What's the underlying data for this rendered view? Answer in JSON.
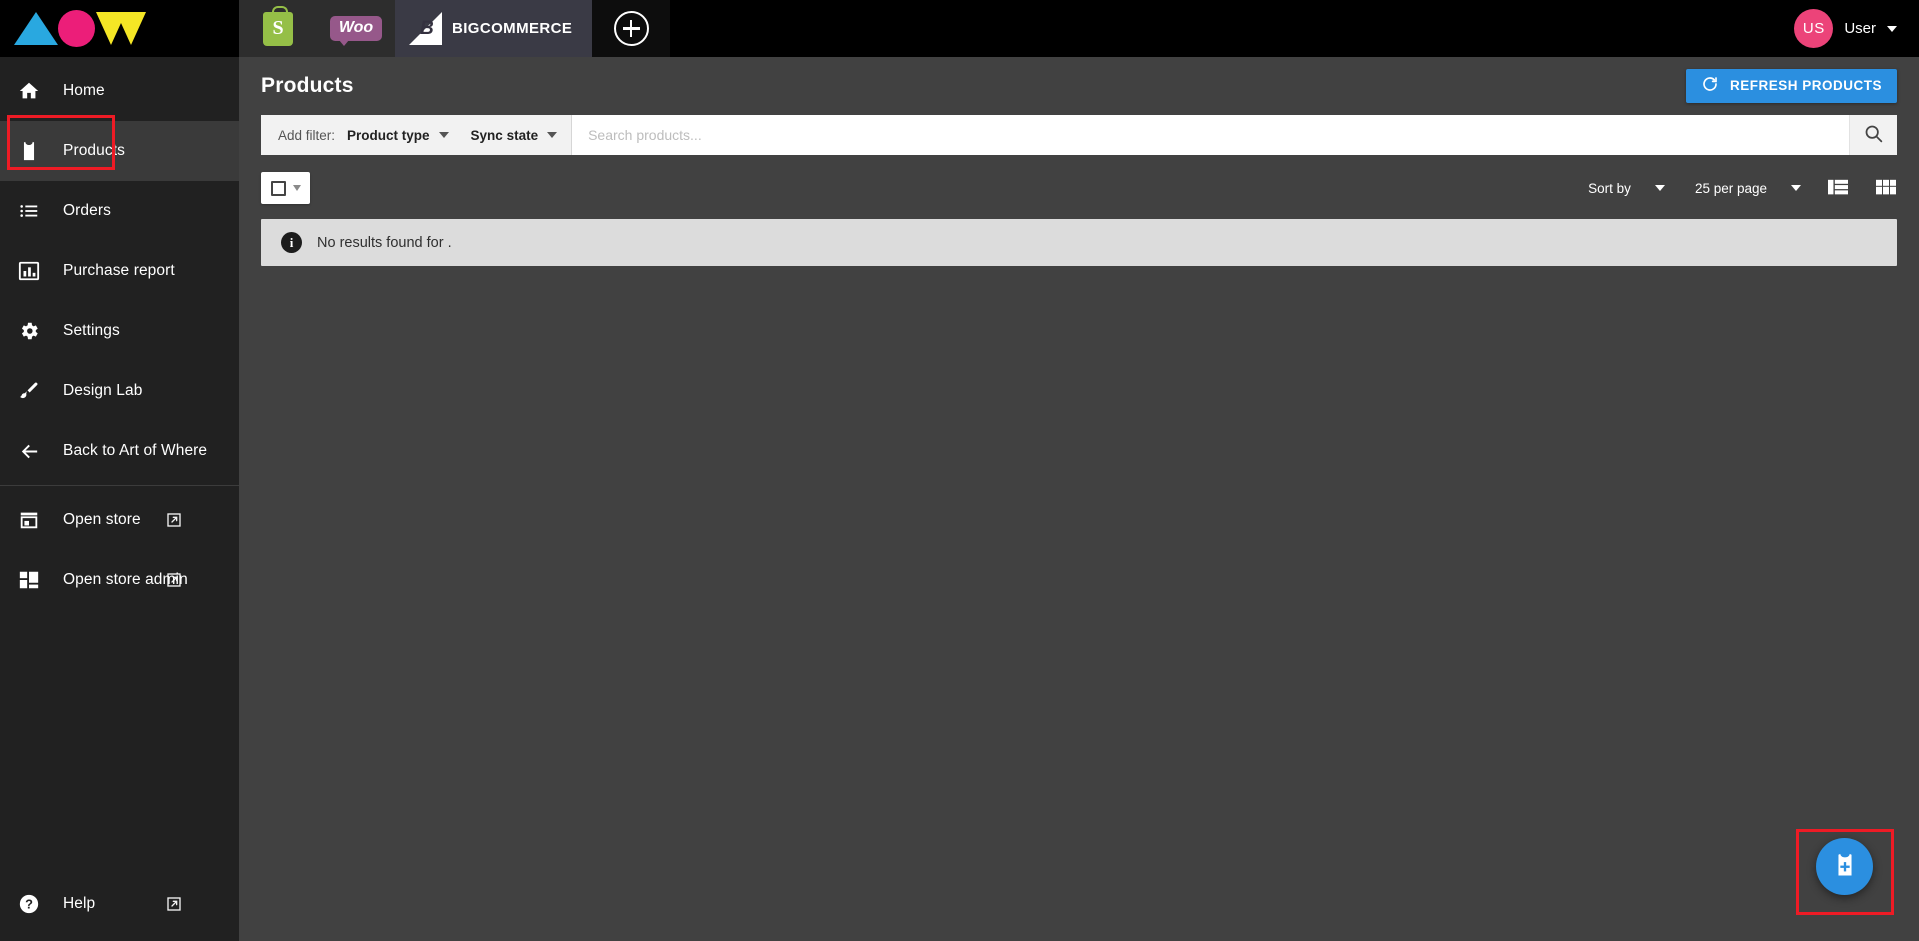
{
  "brand": {
    "logo_alt": "AOW",
    "colors": {
      "triangle": "#29a8e0",
      "circle": "#ec1e79",
      "w": "#f5e625"
    }
  },
  "topbar": {
    "store_tabs": [
      {
        "id": "shopify",
        "label": "S",
        "name": "Shopify",
        "active": false
      },
      {
        "id": "woocommerce",
        "label": "Woo",
        "name": "WooCommerce",
        "active": false
      },
      {
        "id": "bigcommerce",
        "label": "BIGCOMMERCE",
        "mark": "B",
        "name": "BigCommerce",
        "active": true
      }
    ],
    "add_store_label": "+",
    "user": {
      "initials": "US",
      "name": "User"
    }
  },
  "sidebar": {
    "items": [
      {
        "label": "Home",
        "icon": "home-icon",
        "active": false,
        "external": false
      },
      {
        "label": "Products",
        "icon": "shirt-icon",
        "active": true,
        "external": false
      },
      {
        "label": "Orders",
        "icon": "list-icon",
        "active": false,
        "external": false
      },
      {
        "label": "Purchase report",
        "icon": "bar-chart-icon",
        "active": false,
        "external": false
      },
      {
        "label": "Settings",
        "icon": "gear-icon",
        "active": false,
        "external": false
      },
      {
        "label": "Design Lab",
        "icon": "paintbrush-icon",
        "active": false,
        "external": false
      },
      {
        "label": "Back to Art of Where",
        "icon": "arrow-left-icon",
        "active": false,
        "external": false
      },
      {
        "label": "Open store",
        "icon": "storefront-icon",
        "active": false,
        "external": true
      },
      {
        "label": "Open store admin",
        "icon": "dashboard-icon",
        "active": false,
        "external": true
      }
    ],
    "help": {
      "label": "Help",
      "icon": "help-circle-icon",
      "external": true
    }
  },
  "page": {
    "title": "Products",
    "refresh_button": {
      "label": "REFRESH PRODUCTS",
      "icon": "refresh-icon",
      "color": "#2b8fe0"
    }
  },
  "filters": {
    "add_filter_label": "Add filter:",
    "dropdowns": [
      {
        "label": "Product type"
      },
      {
        "label": "Sync state"
      }
    ],
    "search": {
      "placeholder": "Search products...",
      "value": ""
    },
    "search_button_icon": "search-icon"
  },
  "toolbar": {
    "select_all": {
      "icon": "checkbox-icon",
      "caret": "chevron-down-icon"
    },
    "sort_by": {
      "label": "Sort by"
    },
    "per_page": {
      "label": "25 per page"
    },
    "views": [
      {
        "name": "list-view-icon",
        "active": false
      },
      {
        "name": "grid-view-icon",
        "active": true
      }
    ]
  },
  "results": {
    "empty_message": "No results found for .",
    "icon": "info-icon"
  },
  "fab": {
    "icon": "add-product-icon",
    "color": "#2b8fe0"
  }
}
